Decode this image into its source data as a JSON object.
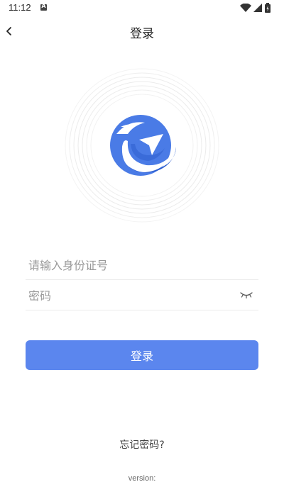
{
  "status_bar": {
    "time": "11:12",
    "notification_icon": "a-icon",
    "icons": [
      "wifi-icon",
      "signal-icon",
      "battery-icon"
    ]
  },
  "nav": {
    "title": "登录",
    "back_icon": "chevron-left-icon"
  },
  "logo": {
    "icon": "app-logo",
    "brand_color": "#4a7be6"
  },
  "form": {
    "id_placeholder": "请输入身份证号",
    "id_value": "",
    "password_placeholder": "密码",
    "password_value": "",
    "eye_icon": "eye-closed-icon"
  },
  "login_button": {
    "label": "登录",
    "color": "#5b86ee"
  },
  "forgot_password": "忘记密码?",
  "version": "version:"
}
